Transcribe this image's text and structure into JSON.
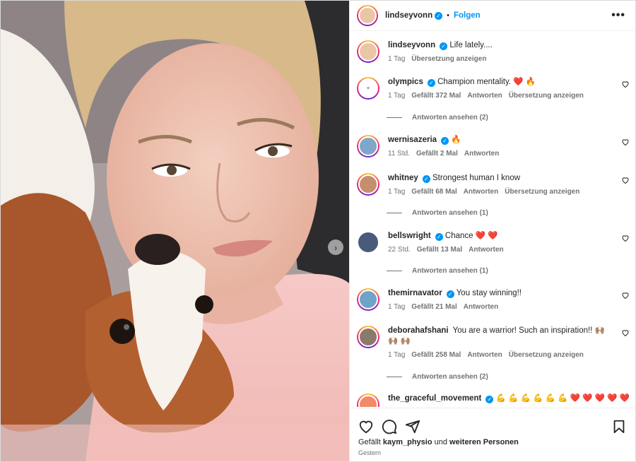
{
  "header": {
    "username": "lindseyvonn",
    "separator": "•",
    "follow_label": "Folgen",
    "more_label": "•••"
  },
  "media": {
    "next_label": "›"
  },
  "caption": {
    "username": "lindseyvonn",
    "text": "Life lately....",
    "time": "1 Tag",
    "translate": "Übersetzung anzeigen"
  },
  "comments": [
    {
      "username": "olympics",
      "text": "Champion mentality. ❤️ 🔥",
      "time": "1 Tag",
      "likes": "Gefällt 372 Mal",
      "reply": "Antworten",
      "translate": "Übersetzung anzeigen",
      "replies": "Antworten ansehen (2)",
      "avatar_color": "#ffffff"
    },
    {
      "username": "wernisazeria",
      "text": "🔥",
      "time": "11 Std.",
      "likes": "Gefällt 2 Mal",
      "reply": "Antworten",
      "translate": "",
      "replies": "",
      "avatar_color": "#7fa7c9"
    },
    {
      "username": "whitney",
      "text": "Strongest human I know",
      "time": "1 Tag",
      "likes": "Gefällt 68 Mal",
      "reply": "Antworten",
      "translate": "Übersetzung anzeigen",
      "replies": "Antworten ansehen (1)",
      "avatar_color": "#c48f6a"
    },
    {
      "username": "bellswright",
      "text": "Chance ❤️ ❤️",
      "time": "22 Std.",
      "likes": "Gefällt 13 Mal",
      "reply": "Antworten",
      "translate": "",
      "replies": "Antworten ansehen (1)",
      "avatar_color": "#4a5a7a"
    },
    {
      "username": "themirnavator",
      "text": "You stay winning!!",
      "time": "1 Tag",
      "likes": "Gefällt 21 Mal",
      "reply": "Antworten",
      "translate": "",
      "replies": "",
      "avatar_color": "#6fa3c8"
    },
    {
      "username": "deborahafshani",
      "text": "You are a warrior! Such an inspiration!! 🙌🏽 🙌🏽 🙌🏽",
      "time": "1 Tag",
      "likes": "Gefällt 258 Mal",
      "reply": "Antworten",
      "translate": "Übersetzung anzeigen",
      "replies": "Antworten ansehen (2)",
      "avatar_color": "#8a7a6a"
    },
    {
      "username": "the_graceful_movement",
      "text": "💪 💪 💪 💪 💪 💪 ❤️ ❤️ ❤️ ❤️ ❤️",
      "time": "",
      "likes": "",
      "reply": "",
      "translate": "",
      "replies": "",
      "avatar_color": "#f08a6a"
    }
  ],
  "footer": {
    "likes_prefix": "Gefällt",
    "liked_by": "kaym_physio",
    "likes_mid": "und",
    "others": "weiteren Personen",
    "date": "Gestern"
  },
  "colors": {
    "accent": "#0095f6",
    "text": "#262626",
    "muted": "#737373"
  },
  "icons": [
    "heart-icon",
    "comment-icon",
    "share-icon",
    "bookmark-icon",
    "verified-icon",
    "more-icon",
    "chevron-right-icon"
  ]
}
